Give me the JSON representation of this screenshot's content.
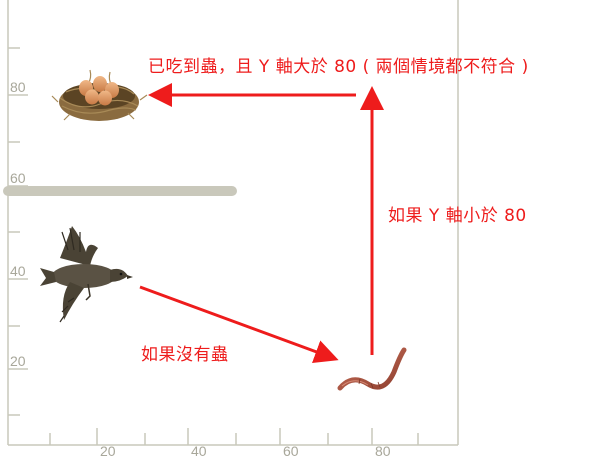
{
  "axes": {
    "y_labels": [
      "80",
      "60",
      "40",
      "20"
    ],
    "x_labels": [
      "20",
      "40",
      "60",
      "80"
    ]
  },
  "annotations": {
    "top": "已吃到蟲，且 Y 軸大於 80 ( 兩個情境都不符合 )",
    "right": "如果 Y 軸小於 80",
    "left": "如果沒有蟲"
  },
  "sprites": {
    "nest": "bird-nest-with-eggs",
    "bird": "flying-duck",
    "worm": "earthworm"
  },
  "colors": {
    "arrow": "#ee1c1c",
    "axis": "#c9c8bb",
    "tick_text": "#a8a79a",
    "bar": "#c9c8bb"
  }
}
